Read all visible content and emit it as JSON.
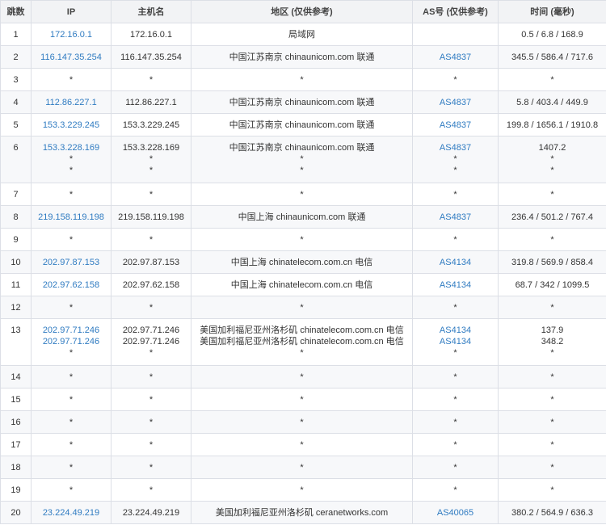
{
  "headers": [
    "跳数",
    "IP",
    "主机名",
    "地区 (仅供参考)",
    "AS号 (仅供参考)",
    "时间 (毫秒)"
  ],
  "rows": [
    {
      "hop": "1",
      "ips": [
        "172.16.0.1"
      ],
      "hosts": [
        "172.16.0.1"
      ],
      "regions": [
        "局域网"
      ],
      "as": [
        ""
      ],
      "times": [
        "0.5 / 6.8 / 168.9"
      ],
      "h": 28
    },
    {
      "hop": "2",
      "ips": [
        "116.147.35.254"
      ],
      "hosts": [
        "116.147.35.254"
      ],
      "regions": [
        "中国江苏南京 chinaunicom.com 联通"
      ],
      "as": [
        "AS4837"
      ],
      "times": [
        "345.5 / 586.4 / 717.6"
      ],
      "h": 28
    },
    {
      "hop": "3",
      "ips": [
        "*"
      ],
      "hosts": [
        "*"
      ],
      "regions": [
        "*"
      ],
      "as": [
        "*"
      ],
      "times": [
        "*"
      ],
      "h": 28
    },
    {
      "hop": "4",
      "ips": [
        "112.86.227.1"
      ],
      "hosts": [
        "112.86.227.1"
      ],
      "regions": [
        "中国江苏南京 chinaunicom.com 联通"
      ],
      "as": [
        "AS4837"
      ],
      "times": [
        "5.8 / 403.4 / 449.9"
      ],
      "h": 28
    },
    {
      "hop": "5",
      "ips": [
        "153.3.229.245"
      ],
      "hosts": [
        "153.3.229.245"
      ],
      "regions": [
        "中国江苏南京 chinaunicom.com 联通"
      ],
      "as": [
        "AS4837"
      ],
      "times": [
        "199.8 / 1656.1 / 1910.8"
      ],
      "h": 28
    },
    {
      "hop": "6",
      "ips": [
        "153.3.228.169",
        "*",
        "*"
      ],
      "hosts": [
        "153.3.228.169",
        "*",
        "*"
      ],
      "regions": [
        "中国江苏南京 chinaunicom.com 联通",
        "*",
        "*"
      ],
      "as": [
        "AS4837",
        "*",
        "*"
      ],
      "times": [
        "1407.2",
        "*",
        "*"
      ],
      "h": 58
    },
    {
      "hop": "7",
      "ips": [
        "*"
      ],
      "hosts": [
        "*"
      ],
      "regions": [
        "*"
      ],
      "as": [
        "*"
      ],
      "times": [
        "*"
      ],
      "h": 28
    },
    {
      "hop": "8",
      "ips": [
        "219.158.119.198"
      ],
      "hosts": [
        "219.158.119.198"
      ],
      "regions": [
        "中国上海 chinaunicom.com 联通"
      ],
      "as": [
        "AS4837"
      ],
      "times": [
        "236.4 / 501.2 / 767.4"
      ],
      "h": 28
    },
    {
      "hop": "9",
      "ips": [
        "*"
      ],
      "hosts": [
        "*"
      ],
      "regions": [
        "*"
      ],
      "as": [
        "*"
      ],
      "times": [
        "*"
      ],
      "h": 28
    },
    {
      "hop": "10",
      "ips": [
        "202.97.87.153"
      ],
      "hosts": [
        "202.97.87.153"
      ],
      "regions": [
        "中国上海 chinatelecom.com.cn 电信"
      ],
      "as": [
        "AS4134"
      ],
      "times": [
        "319.8 / 569.9 / 858.4"
      ],
      "h": 28
    },
    {
      "hop": "11",
      "ips": [
        "202.97.62.158"
      ],
      "hosts": [
        "202.97.62.158"
      ],
      "regions": [
        "中国上海 chinatelecom.com.cn 电信"
      ],
      "as": [
        "AS4134"
      ],
      "times": [
        "68.7 / 342 / 1099.5"
      ],
      "h": 28
    },
    {
      "hop": "12",
      "ips": [
        "*"
      ],
      "hosts": [
        "*"
      ],
      "regions": [
        "*"
      ],
      "as": [
        "*"
      ],
      "times": [
        "*"
      ],
      "h": 28
    },
    {
      "hop": "13",
      "ips": [
        "202.97.71.246",
        "202.97.71.246",
        "*"
      ],
      "hosts": [
        "202.97.71.246",
        "202.97.71.246",
        "*"
      ],
      "regions": [
        "美国加利福尼亚州洛杉矶 chinatelecom.com.cn 电信",
        "美国加利福尼亚州洛杉矶 chinatelecom.com.cn 电信",
        "*"
      ],
      "as": [
        "AS4134",
        "AS4134",
        "*"
      ],
      "times": [
        "137.9",
        "348.2",
        "*"
      ],
      "h": 58
    },
    {
      "hop": "14",
      "ips": [
        "*"
      ],
      "hosts": [
        "*"
      ],
      "regions": [
        "*"
      ],
      "as": [
        "*"
      ],
      "times": [
        "*"
      ],
      "h": 28
    },
    {
      "hop": "15",
      "ips": [
        "*"
      ],
      "hosts": [
        "*"
      ],
      "regions": [
        "*"
      ],
      "as": [
        "*"
      ],
      "times": [
        "*"
      ],
      "h": 28
    },
    {
      "hop": "16",
      "ips": [
        "*"
      ],
      "hosts": [
        "*"
      ],
      "regions": [
        "*"
      ],
      "as": [
        "*"
      ],
      "times": [
        "*"
      ],
      "h": 28
    },
    {
      "hop": "17",
      "ips": [
        "*"
      ],
      "hosts": [
        "*"
      ],
      "regions": [
        "*"
      ],
      "as": [
        "*"
      ],
      "times": [
        "*"
      ],
      "h": 28
    },
    {
      "hop": "18",
      "ips": [
        "*"
      ],
      "hosts": [
        "*"
      ],
      "regions": [
        "*"
      ],
      "as": [
        "*"
      ],
      "times": [
        "*"
      ],
      "h": 28
    },
    {
      "hop": "19",
      "ips": [
        "*"
      ],
      "hosts": [
        "*"
      ],
      "regions": [
        "*"
      ],
      "as": [
        "*"
      ],
      "times": [
        "*"
      ],
      "h": 28
    },
    {
      "hop": "20",
      "ips": [
        "23.224.49.219"
      ],
      "hosts": [
        "23.224.49.219"
      ],
      "regions": [
        "美国加利福尼亚州洛杉矶 ceranetworks.com"
      ],
      "as": [
        "AS40065"
      ],
      "times": [
        "380.2 / 564.9 / 636.3"
      ],
      "h": 28
    }
  ],
  "colors": {
    "link": "#2f7bc1",
    "header_bg": "#f2f3f5",
    "border": "#dcdfe6",
    "row_alt": "#f7f8fa"
  }
}
